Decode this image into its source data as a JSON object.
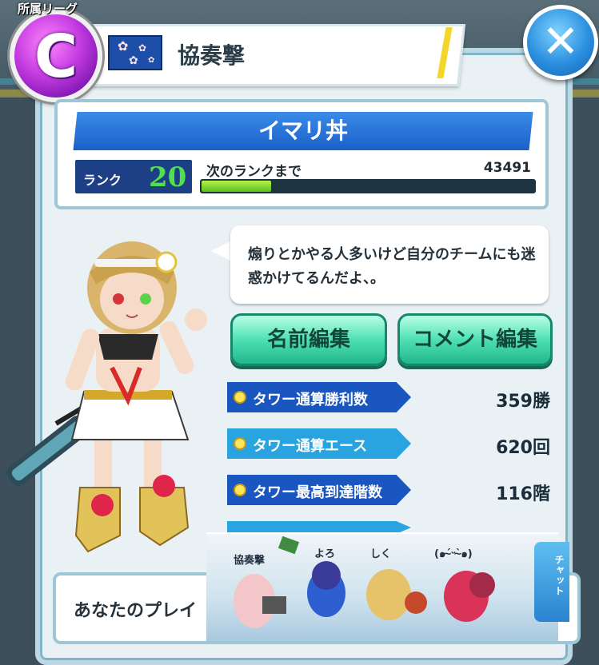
{
  "league": {
    "label": "所属リーグ",
    "letter": "C"
  },
  "team": {
    "name": "協奏撃"
  },
  "player": {
    "name": "イマリ丼",
    "rank_label": "ランク",
    "rank": "20",
    "next_rank_label": "次のランクまで",
    "next_rank_value": "43491",
    "xp_progress": 0.21
  },
  "comment": "煽りとかやる人多いけど自分のチームにも迷惑かけてるんだよ、。",
  "buttons": {
    "edit_name": "名前編集",
    "edit_comment": "コメント編集"
  },
  "stats": [
    {
      "label": "タワー通算勝利数",
      "value": "359勝"
    },
    {
      "label": "タワー通算エース",
      "value": "620回"
    },
    {
      "label": "タワー最高到達階数",
      "value": "116階"
    }
  ],
  "play_style_text": "あなたのプレイ",
  "chat": {
    "tab_label": "チャット",
    "members": [
      "協奏撃",
      "よろ",
      "しく",
      "(๑ˊ̴ᵕˋ̴๑)"
    ]
  },
  "colors": {
    "accent": "#1b5fc9",
    "rank_green": "#52e04a",
    "button_green": "#4ee0b2"
  }
}
